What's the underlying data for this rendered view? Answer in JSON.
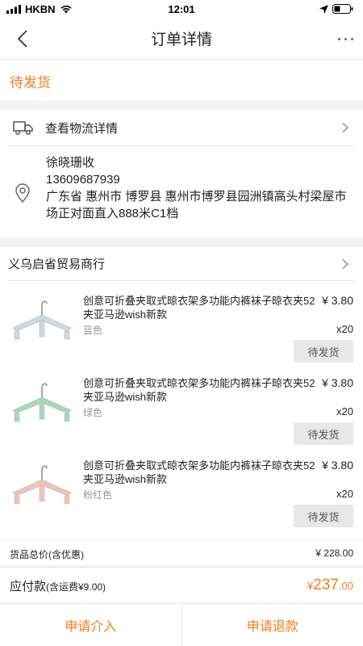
{
  "status_bar": {
    "carrier": "HKBN",
    "time": "12:01"
  },
  "nav": {
    "title": "订单详情"
  },
  "order_status": "待发货",
  "logistics": {
    "label": "查看物流详情"
  },
  "address": {
    "name": "徐晓珊收",
    "phone": "13609687939",
    "line": "广东省 惠州市 博罗县 惠州市博罗县园洲镇高头村梁屋市场正对面直入888米C1档"
  },
  "shop": {
    "name": "义乌启省贸易商行"
  },
  "items": [
    {
      "title": "创意可折叠夹取式晾衣架多功能内裤袜子晾衣夹52夹亚马逊wish新款",
      "price": "¥ 3.80",
      "sku": "蓝色",
      "qty": "x20",
      "status": "待发货",
      "color": "#cfd8de"
    },
    {
      "title": "创意可折叠夹取式晾衣架多功能内裤袜子晾衣夹52夹亚马逊wish新款",
      "price": "¥ 3.80",
      "sku": "绿色",
      "qty": "x20",
      "status": "待发货",
      "color": "#a9d6bd"
    },
    {
      "title": "创意可折叠夹取式晾衣架多功能内裤袜子晾衣夹52夹亚马逊wish新款",
      "price": "¥ 3.80",
      "sku": "粉红色",
      "qty": "x20",
      "status": "待发货",
      "color": "#edc3bd"
    }
  ],
  "summary": {
    "goods_total_label": "货品总价(含优惠)",
    "goods_total_value": "¥ 228.00"
  },
  "payable": {
    "label": "应付款",
    "note": "(含运费¥9.00)",
    "currency": "¥",
    "amount_int": "237",
    "amount_dec": ".00"
  },
  "actions": {
    "intervene": "申请介入",
    "refund": "申请退款"
  },
  "colors": {
    "accent": "#ef7d1c"
  }
}
